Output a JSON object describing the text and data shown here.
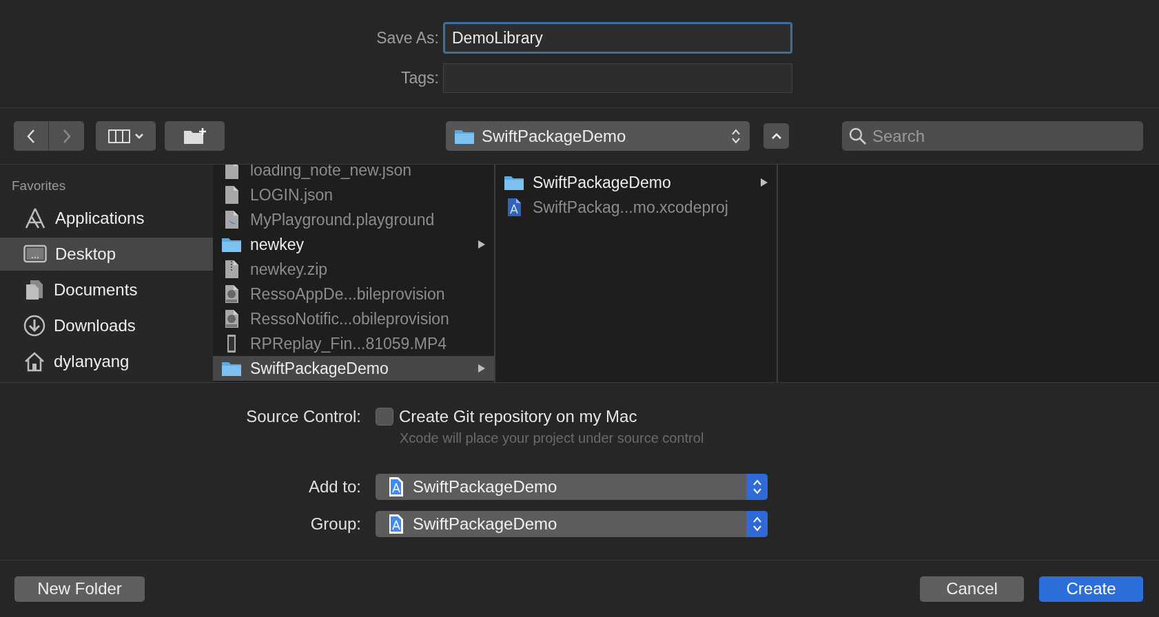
{
  "save_as": {
    "label": "Save As:",
    "value": "DemoLibrary"
  },
  "tags": {
    "label": "Tags:"
  },
  "toolbar": {
    "location": "SwiftPackageDemo",
    "search": {
      "placeholder": "Search"
    }
  },
  "sidebar": {
    "heading": "Favorites",
    "items": [
      {
        "label": "Applications",
        "kind": "apps",
        "selected": false
      },
      {
        "label": "Desktop",
        "kind": "desktop",
        "selected": true
      },
      {
        "label": "Documents",
        "kind": "documents",
        "selected": false
      },
      {
        "label": "Downloads",
        "kind": "downloads",
        "selected": false
      },
      {
        "label": "dylanyang",
        "kind": "home",
        "selected": false
      }
    ]
  },
  "columns": [
    {
      "items": [
        {
          "name": "loading_note_new.json",
          "kind": "file",
          "selected": false
        },
        {
          "name": "LOGIN.json",
          "kind": "file",
          "selected": false
        },
        {
          "name": "MyPlayground.playground",
          "kind": "playground",
          "selected": false
        },
        {
          "name": "newkey",
          "kind": "folder",
          "selected": false
        },
        {
          "name": "newkey.zip",
          "kind": "zip",
          "selected": false
        },
        {
          "name": "RessoAppDe...bileprovision",
          "kind": "provision",
          "selected": false
        },
        {
          "name": "RessoNotific...obileprovision",
          "kind": "provision",
          "selected": false
        },
        {
          "name": "RPReplay_Fin...81059.MP4",
          "kind": "video",
          "selected": false
        },
        {
          "name": "SwiftPackageDemo",
          "kind": "folder",
          "selected": true
        }
      ]
    },
    {
      "items": [
        {
          "name": "SwiftPackageDemo",
          "kind": "folder",
          "selected": false
        },
        {
          "name": "SwiftPackag...mo.xcodeproj",
          "kind": "xcodeproj",
          "selected": false
        }
      ]
    }
  ],
  "source_control": {
    "label": "Source Control:",
    "checkbox": {
      "label": "Create Git repository on my Mac",
      "checked": false
    },
    "hint": "Xcode will place your project under source control"
  },
  "add_to": {
    "label": "Add to:",
    "value": "SwiftPackageDemo"
  },
  "group": {
    "label": "Group:",
    "value": "SwiftPackageDemo"
  },
  "buttons": [
    {
      "label": "New Folder",
      "kind": "secondary"
    },
    {
      "label": "Cancel",
      "kind": "secondary"
    },
    {
      "label": "Create",
      "kind": "primary"
    }
  ]
}
